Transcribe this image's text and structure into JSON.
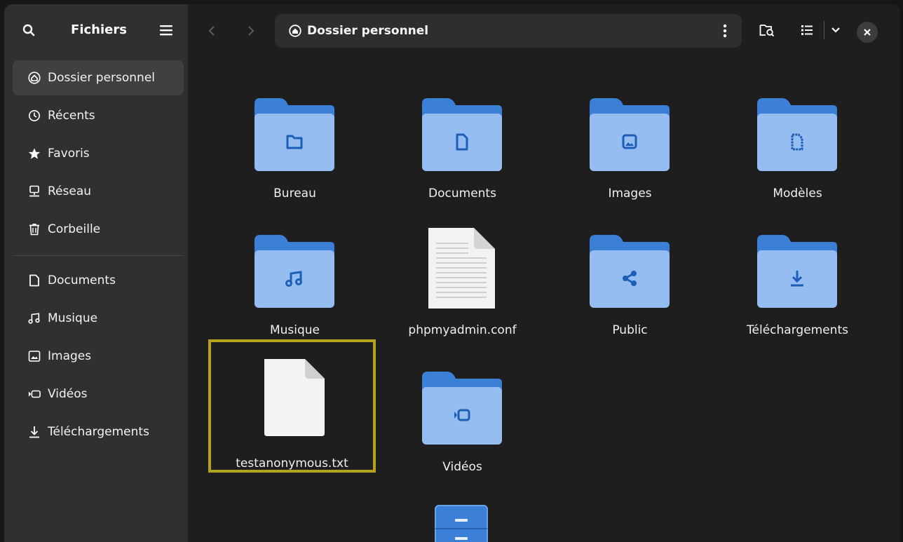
{
  "sidebar": {
    "title": "Fichiers",
    "header_icons": [
      "search-icon",
      "hamburger-menu-icon"
    ],
    "places": [
      {
        "label": "Dossier personnel",
        "icon": "home-icon",
        "active": true
      },
      {
        "label": "Récents",
        "icon": "clock-icon"
      },
      {
        "label": "Favoris",
        "icon": "star-icon"
      },
      {
        "label": "Réseau",
        "icon": "network-icon"
      },
      {
        "label": "Corbeille",
        "icon": "trash-icon"
      }
    ],
    "bookmarks": [
      {
        "label": "Documents",
        "icon": "document-icon"
      },
      {
        "label": "Musique",
        "icon": "music-icon"
      },
      {
        "label": "Images",
        "icon": "image-icon"
      },
      {
        "label": "Vidéos",
        "icon": "video-icon"
      },
      {
        "label": "Téléchargements",
        "icon": "download-icon"
      }
    ]
  },
  "header": {
    "path_label": "Dossier personnel",
    "path_icon": "home-icon",
    "buttons": [
      "back-arrow-icon",
      "forward-arrow-icon",
      "kebab-menu-icon",
      "search-folder-icon",
      "list-view-icon",
      "chevron-down-icon",
      "close-icon"
    ]
  },
  "files": [
    {
      "name": "Bureau",
      "kind": "folder",
      "emblem": "folder"
    },
    {
      "name": "Documents",
      "kind": "folder",
      "emblem": "document"
    },
    {
      "name": "Images",
      "kind": "folder",
      "emblem": "image"
    },
    {
      "name": "Modèles",
      "kind": "folder",
      "emblem": "template"
    },
    {
      "name": "Musique",
      "kind": "folder",
      "emblem": "music"
    },
    {
      "name": "phpmyadmin.conf",
      "kind": "text-file"
    },
    {
      "name": "Public",
      "kind": "folder",
      "emblem": "share"
    },
    {
      "name": "Téléchargements",
      "kind": "folder",
      "emblem": "download"
    },
    {
      "name": "testanonymous.txt",
      "kind": "blank-file",
      "selected": true
    },
    {
      "name": "Vidéos",
      "kind": "folder",
      "emblem": "video"
    },
    {
      "name": "",
      "kind": "archive"
    }
  ],
  "colors": {
    "folder_back": "#3c7fd6",
    "folder_front": "#95bdf1",
    "folder_emblem": "#1c5fb5",
    "selection": "#b3a31c",
    "sidebar_bg": "#303030",
    "main_bg": "#1e1e1e"
  }
}
